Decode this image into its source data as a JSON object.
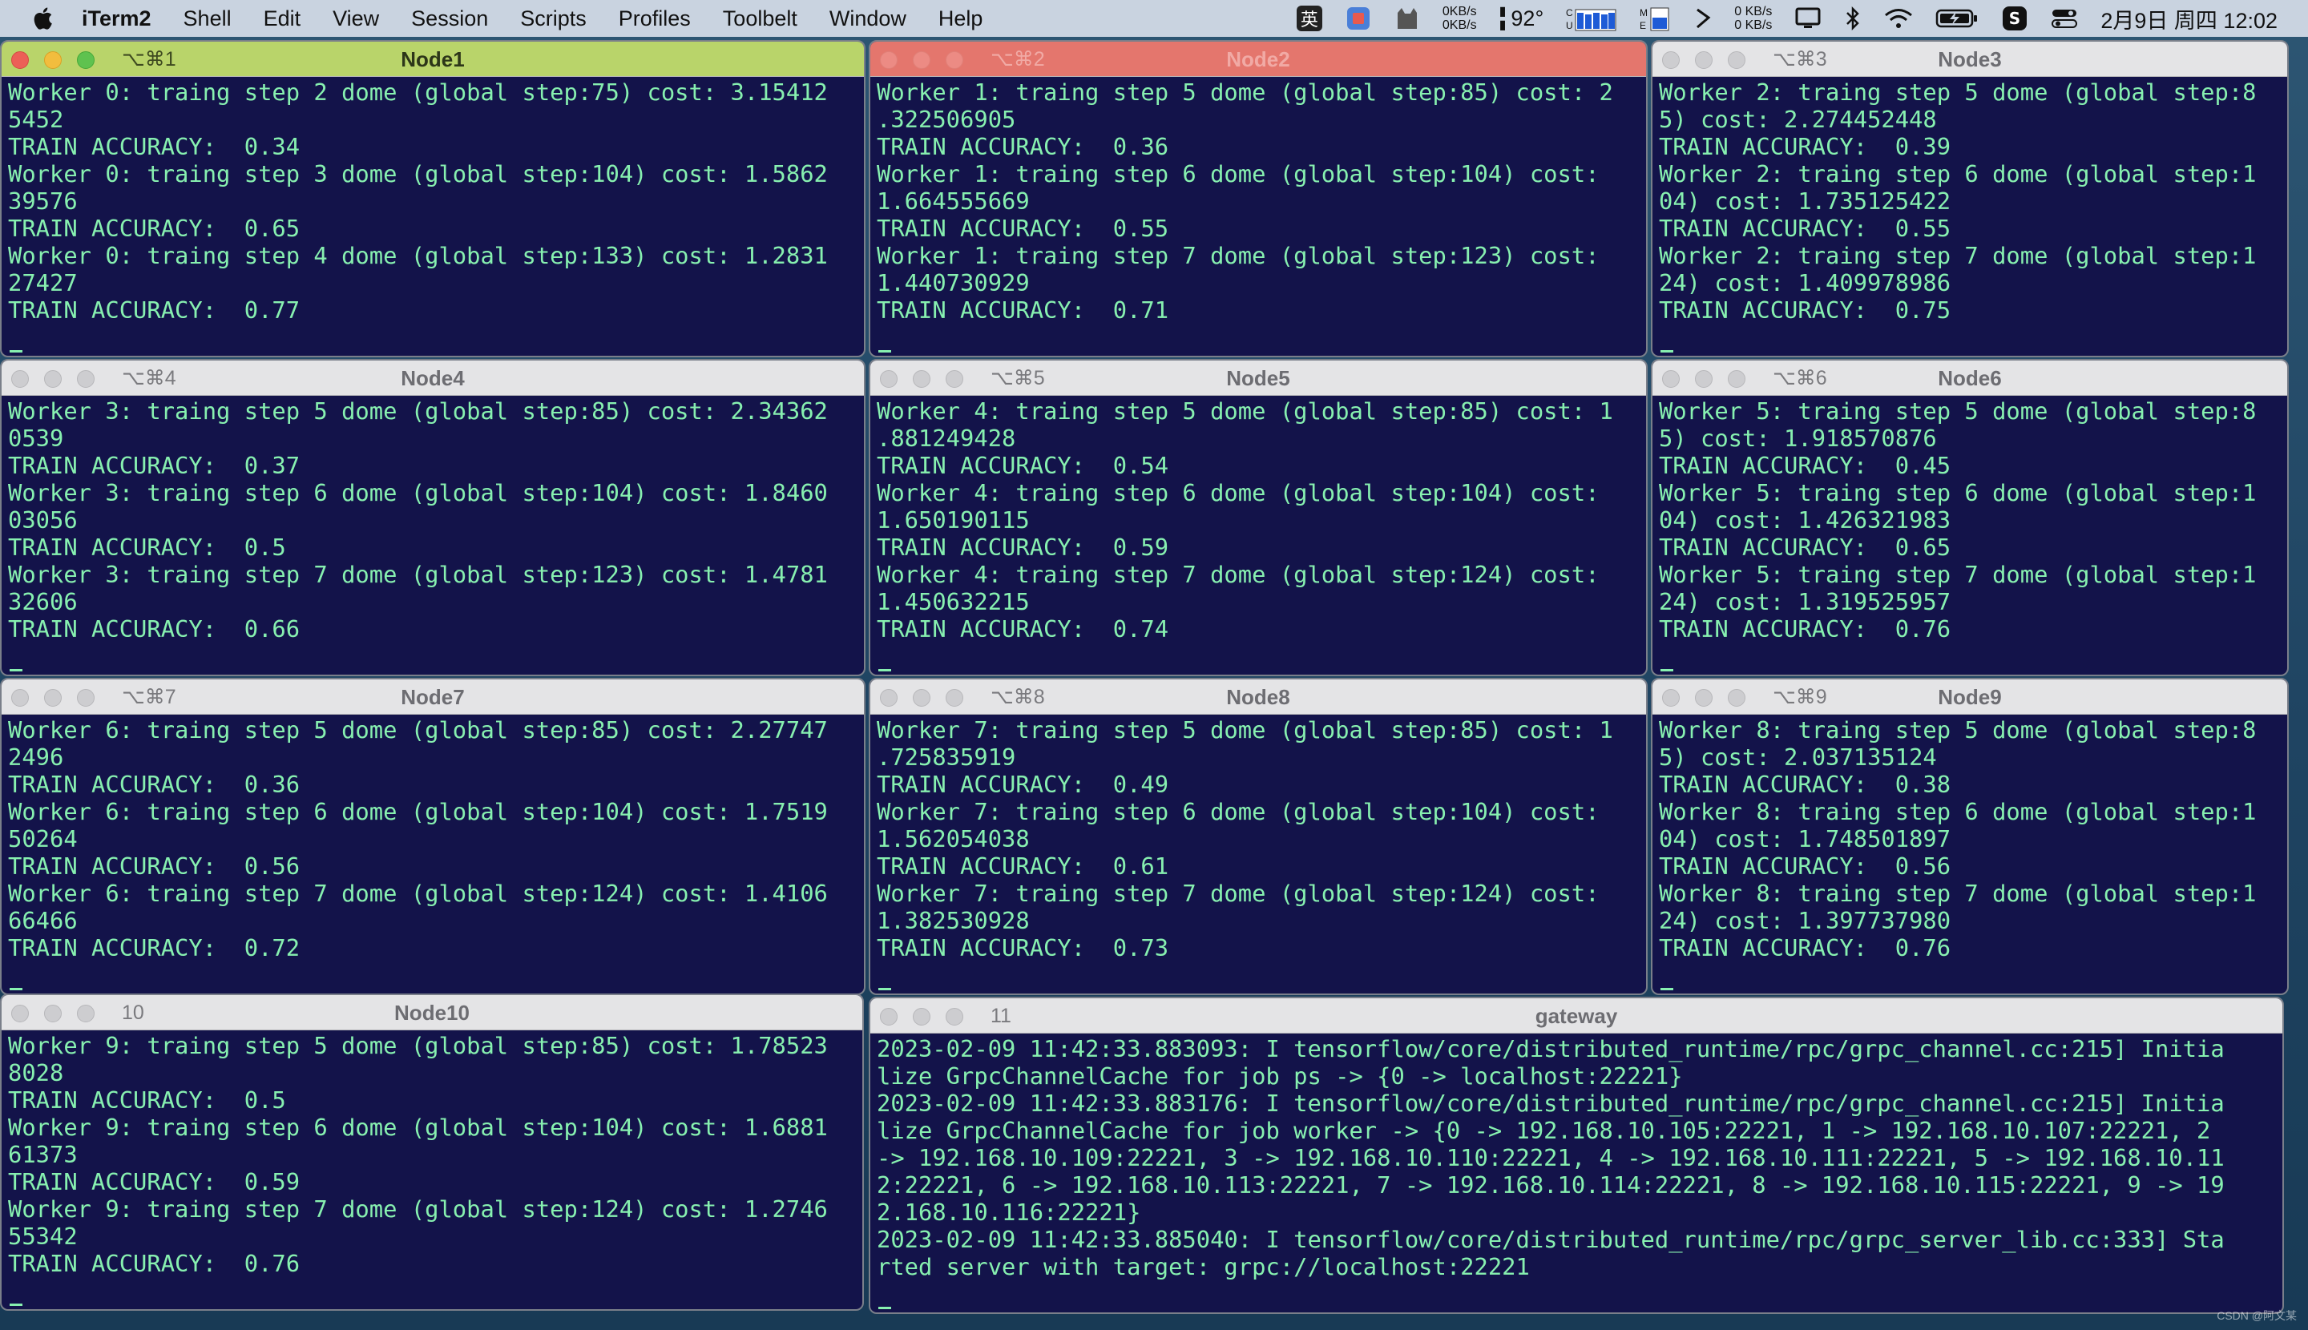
{
  "menubar": {
    "apple": "apple-logo",
    "app_name": "iTerm2",
    "items": [
      "Shell",
      "Edit",
      "View",
      "Session",
      "Scripts",
      "Profiles",
      "Toolbelt",
      "Window",
      "Help"
    ],
    "status": {
      "ime": "英",
      "net_up": "0KB/s",
      "net_down": "0KB/s",
      "temp": "92°",
      "net2_up": "0 KB/s",
      "net2_down": "0 KB/s",
      "date_time": "2月9日 周四  12:02"
    }
  },
  "panes": [
    {
      "shortcut": "⌥⌘1",
      "title": "Node1",
      "state": "active",
      "lines": [
        "Worker 0: traing step 2 dome (global step:75) cost: 3.15412",
        "5452",
        "TRAIN ACCURACY:  0.34",
        "Worker 0: traing step 3 dome (global step:104) cost: 1.5862",
        "39576",
        "TRAIN ACCURACY:  0.65",
        "Worker 0: traing step 4 dome (global step:133) cost: 1.2831",
        "27427",
        "TRAIN ACCURACY:  0.77"
      ]
    },
    {
      "shortcut": "⌥⌘2",
      "title": "Node2",
      "state": "alert",
      "lines": [
        "Worker 1: traing step 5 dome (global step:85) cost: 2",
        ".322506905",
        "TRAIN ACCURACY:  0.36",
        "Worker 1: traing step 6 dome (global step:104) cost:",
        "1.664555669",
        "TRAIN ACCURACY:  0.55",
        "Worker 1: traing step 7 dome (global step:123) cost:",
        "1.440730929",
        "TRAIN ACCURACY:  0.71"
      ]
    },
    {
      "shortcut": "⌥⌘3",
      "title": "Node3",
      "state": "normal",
      "lines": [
        "Worker 2: traing step 5 dome (global step:8",
        "5) cost: 2.274452448",
        "TRAIN ACCURACY:  0.39",
        "Worker 2: traing step 6 dome (global step:1",
        "04) cost: 1.735125422",
        "TRAIN ACCURACY:  0.55",
        "Worker 2: traing step 7 dome (global step:1",
        "24) cost: 1.409978986",
        "TRAIN ACCURACY:  0.75"
      ]
    },
    {
      "shortcut": "⌥⌘4",
      "title": "Node4",
      "state": "normal",
      "lines": [
        "Worker 3: traing step 5 dome (global step:85) cost: 2.34362",
        "0539",
        "TRAIN ACCURACY:  0.37",
        "Worker 3: traing step 6 dome (global step:104) cost: 1.8460",
        "03056",
        "TRAIN ACCURACY:  0.5",
        "Worker 3: traing step 7 dome (global step:123) cost: 1.4781",
        "32606",
        "TRAIN ACCURACY:  0.66"
      ]
    },
    {
      "shortcut": "⌥⌘5",
      "title": "Node5",
      "state": "normal",
      "lines": [
        "Worker 4: traing step 5 dome (global step:85) cost: 1",
        ".881249428",
        "TRAIN ACCURACY:  0.54",
        "Worker 4: traing step 6 dome (global step:104) cost:",
        "1.650190115",
        "TRAIN ACCURACY:  0.59",
        "Worker 4: traing step 7 dome (global step:124) cost:",
        "1.450632215",
        "TRAIN ACCURACY:  0.74"
      ]
    },
    {
      "shortcut": "⌥⌘6",
      "title": "Node6",
      "state": "normal",
      "lines": [
        "Worker 5: traing step 5 dome (global step:8",
        "5) cost: 1.918570876",
        "TRAIN ACCURACY:  0.45",
        "Worker 5: traing step 6 dome (global step:1",
        "04) cost: 1.426321983",
        "TRAIN ACCURACY:  0.65",
        "Worker 5: traing step 7 dome (global step:1",
        "24) cost: 1.319525957",
        "TRAIN ACCURACY:  0.76"
      ]
    },
    {
      "shortcut": "⌥⌘7",
      "title": "Node7",
      "state": "normal",
      "lines": [
        "Worker 6: traing step 5 dome (global step:85) cost: 2.27747",
        "2496",
        "TRAIN ACCURACY:  0.36",
        "Worker 6: traing step 6 dome (global step:104) cost: 1.7519",
        "50264",
        "TRAIN ACCURACY:  0.56",
        "Worker 6: traing step 7 dome (global step:124) cost: 1.4106",
        "66466",
        "TRAIN ACCURACY:  0.72"
      ]
    },
    {
      "shortcut": "⌥⌘8",
      "title": "Node8",
      "state": "normal",
      "lines": [
        "Worker 7: traing step 5 dome (global step:85) cost: 1",
        ".725835919",
        "TRAIN ACCURACY:  0.49",
        "Worker 7: traing step 6 dome (global step:104) cost:",
        "1.562054038",
        "TRAIN ACCURACY:  0.61",
        "Worker 7: traing step 7 dome (global step:124) cost:",
        "1.382530928",
        "TRAIN ACCURACY:  0.73"
      ]
    },
    {
      "shortcut": "⌥⌘9",
      "title": "Node9",
      "state": "normal",
      "lines": [
        "Worker 8: traing step 5 dome (global step:8",
        "5) cost: 2.037135124",
        "TRAIN ACCURACY:  0.38",
        "Worker 8: traing step 6 dome (global step:1",
        "04) cost: 1.748501897",
        "TRAIN ACCURACY:  0.56",
        "Worker 8: traing step 7 dome (global step:1",
        "24) cost: 1.397737980",
        "TRAIN ACCURACY:  0.76"
      ]
    },
    {
      "shortcut": "10",
      "title": "Node10",
      "state": "normal",
      "lines": [
        "Worker 9: traing step 5 dome (global step:85) cost: 1.78523",
        "8028",
        "TRAIN ACCURACY:  0.5",
        "Worker 9: traing step 6 dome (global step:104) cost: 1.6881",
        "61373",
        "TRAIN ACCURACY:  0.59",
        "Worker 9: traing step 7 dome (global step:124) cost: 1.2746",
        "55342",
        "TRAIN ACCURACY:  0.76"
      ]
    },
    {
      "shortcut": "11",
      "title": "gateway",
      "state": "normal",
      "lines": [
        "2023-02-09 11:42:33.883093: I tensorflow/core/distributed_runtime/rpc/grpc_channel.cc:215] Initia",
        "lize GrpcChannelCache for job ps -> {0 -> localhost:22221}",
        "2023-02-09 11:42:33.883176: I tensorflow/core/distributed_runtime/rpc/grpc_channel.cc:215] Initia",
        "lize GrpcChannelCache for job worker -> {0 -> 192.168.10.105:22221, 1 -> 192.168.10.107:22221, 2",
        "-> 192.168.10.109:22221, 3 -> 192.168.10.110:22221, 4 -> 192.168.10.111:22221, 5 -> 192.168.10.11",
        "2:22221, 6 -> 192.168.10.113:22221, 7 -> 192.168.10.114:22221, 8 -> 192.168.10.115:22221, 9 -> 19",
        "2.168.10.116:22221}",
        "2023-02-09 11:42:33.885040: I tensorflow/core/distributed_runtime/rpc/grpc_server_lib.cc:333] Sta",
        "rted server with target: grpc://localhost:22221"
      ]
    }
  ],
  "watermark": "CSDN @阿文某"
}
